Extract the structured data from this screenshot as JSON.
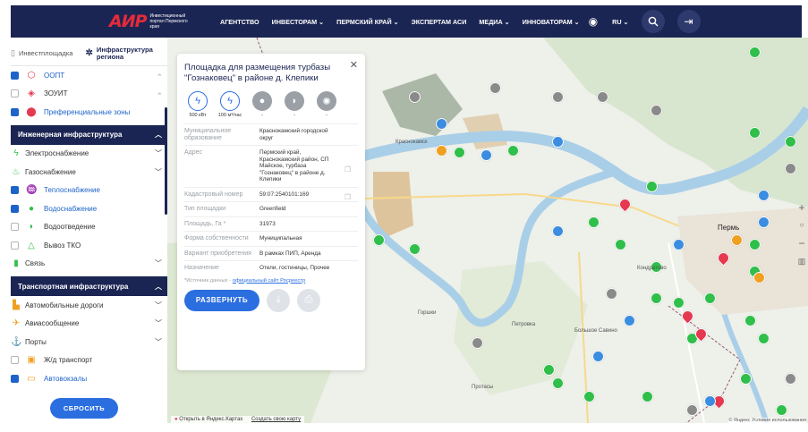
{
  "header": {
    "logo_mark": "АИР",
    "logo_text": "Инвестиционный портал Пермского края",
    "nav": [
      {
        "label": "АГЕНТСТВО"
      },
      {
        "label": "ИНВЕСТОРАМ ⌄"
      },
      {
        "label": "ПЕРМСКИЙ КРАЙ ⌄"
      },
      {
        "label": "ЭКСПЕРТАМ АСИ"
      },
      {
        "label": "МЕДИА ⌄"
      },
      {
        "label": "ИННОВАТОРАМ ⌄"
      }
    ],
    "lang": "RU ⌄"
  },
  "left_panel": {
    "tabs": [
      {
        "label": "Инвестплощадка"
      },
      {
        "label": "Инфраструктура региона"
      }
    ],
    "top_items": [
      {
        "label": "ООПТ",
        "checked": true
      },
      {
        "label": "ЗОУИТ",
        "checked": false
      },
      {
        "label": "Преференциальные зоны",
        "checked": true
      }
    ],
    "engineering": {
      "title": "Инженерная инфраструктура",
      "groups": [
        {
          "label": "Электроснабжение"
        },
        {
          "label": "Газоснабжение"
        }
      ],
      "items": [
        {
          "label": "Теплоснабжение",
          "checked": true
        },
        {
          "label": "Водоснабжение",
          "checked": true
        },
        {
          "label": "Водоотведение",
          "checked": false
        },
        {
          "label": "Вывоз ТКО",
          "checked": false
        }
      ],
      "link_group": {
        "label": "Связь"
      }
    },
    "transport": {
      "title": "Транспортная инфраструктура",
      "groups": [
        {
          "label": "Автомобильные дороги"
        },
        {
          "label": "Авиасообщение"
        },
        {
          "label": "Порты"
        }
      ],
      "items": [
        {
          "label": "Ж/д транспорт",
          "checked": false
        },
        {
          "label": "Автовокзалы",
          "checked": true
        }
      ]
    },
    "reset_label": "СБРОСИТЬ"
  },
  "card": {
    "title": "Площадка для размещения турбазы \"Гознаковец\" в районе д. Клепики",
    "utilities": [
      {
        "icon": "lightning-icon",
        "value": "500 кВт",
        "active": true
      },
      {
        "icon": "lightning-icon",
        "value": "100 м³/час",
        "active": true
      },
      {
        "icon": "drop-icon",
        "value": "-",
        "active": false
      },
      {
        "icon": "pipe-icon",
        "value": "-",
        "active": false
      },
      {
        "icon": "sun-icon",
        "value": "-",
        "active": false
      }
    ],
    "attributes": [
      {
        "key": "Муниципальное образование",
        "value": "Краснокамский городской округ"
      },
      {
        "key": "Адрес",
        "value": "Пермский край, Краснокамский район, СП Майское, турбаза \"Гознаковец\" в районе д. Клепики"
      },
      {
        "key": "Кадастровый номер",
        "value": "59:07:2540101:169"
      },
      {
        "key": "Тип площадки",
        "value": "Greenfield"
      },
      {
        "key": "Площадь, Га *",
        "value": "31973"
      },
      {
        "key": "Форма собственности",
        "value": "Муниципальная"
      },
      {
        "key": "Вариант приобретения",
        "value": "В рамках ПИП, Аренда"
      },
      {
        "key": "Назначение",
        "value": "Отели, гостиницы, Прочее"
      }
    ],
    "source_prefix": "*Источник данных - ",
    "source_link": "официальный сайт Росреестр",
    "expand_label": "РАЗВЕРНУТЬ"
  },
  "map": {
    "labels": [
      {
        "text": "Краснокамск"
      },
      {
        "text": "Пермь"
      },
      {
        "text": "Кондратово"
      },
      {
        "text": "Горшки"
      },
      {
        "text": "Протасы"
      },
      {
        "text": "Петровка"
      },
      {
        "text": "Большое Савино"
      }
    ],
    "footer_open": "Открыть в Яндекс.Картах",
    "footer_create": "Создать свою карту",
    "copyright": "© Яндекс Условия использования"
  }
}
